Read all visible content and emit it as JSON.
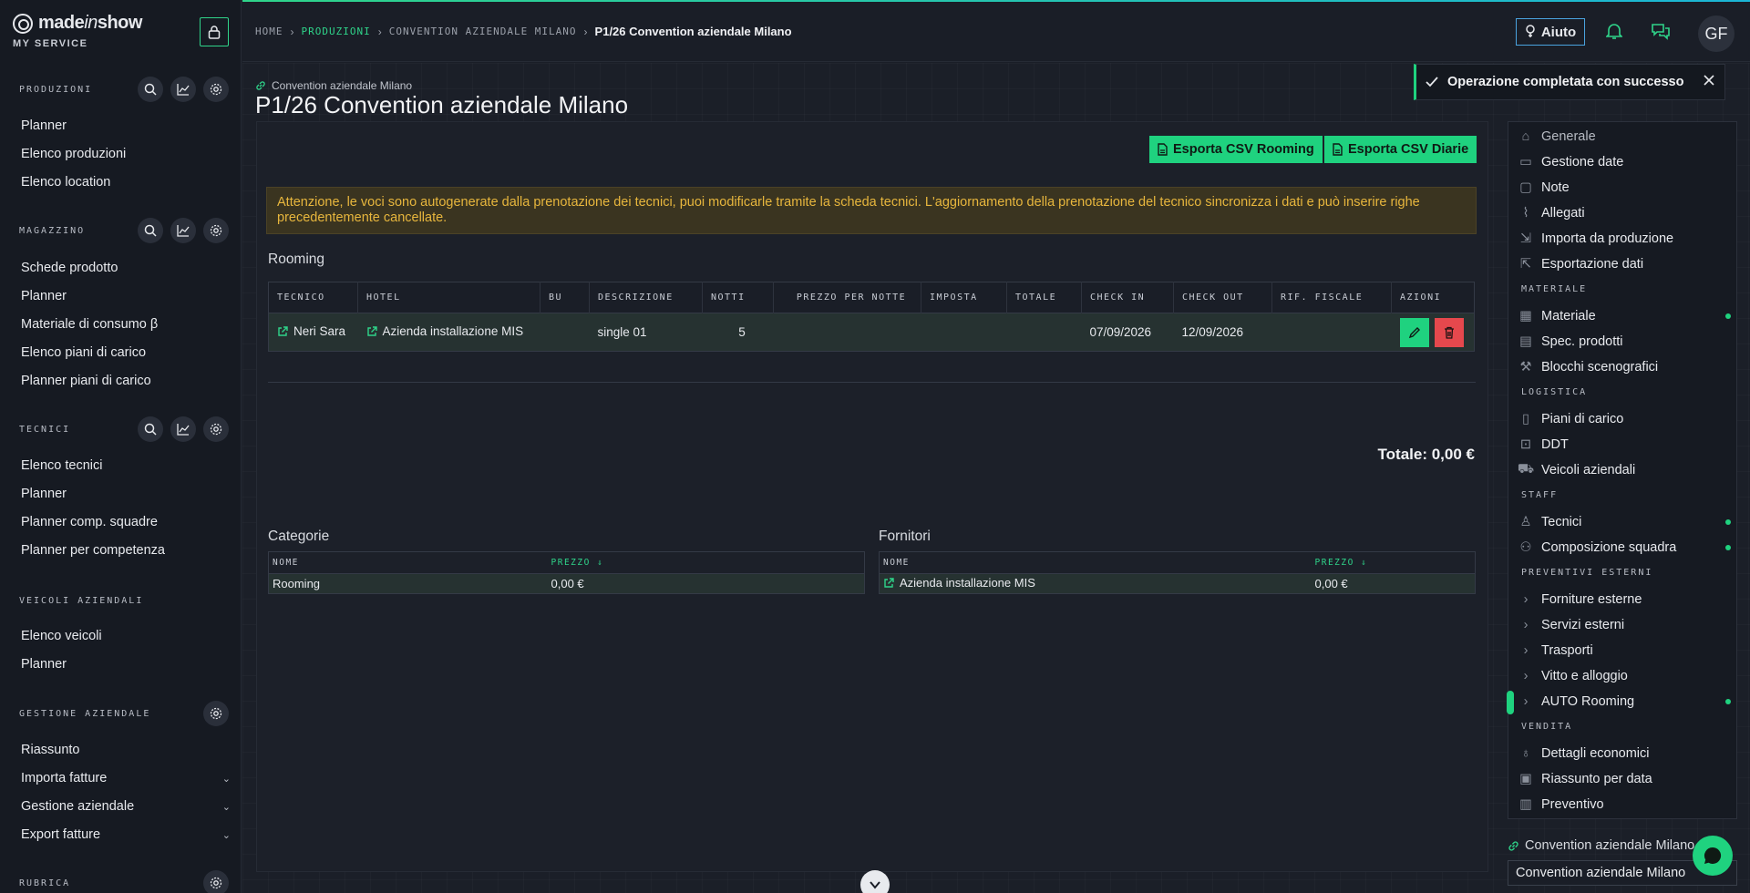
{
  "brand": {
    "name_a": "made",
    "name_b": "in",
    "name_c": "show",
    "service": "MY SERVICE"
  },
  "sidebar": {
    "produzioni": {
      "title": "PRODUZIONI",
      "items": [
        "Planner",
        "Elenco produzioni",
        "Elenco location"
      ]
    },
    "magazzino": {
      "title": "MAGAZZINO",
      "items": [
        "Schede prodotto",
        "Planner",
        "Materiale di consumo β",
        "Elenco piani di carico",
        "Planner piani di carico"
      ]
    },
    "tecnici": {
      "title": "TECNICI",
      "items": [
        "Elenco tecnici",
        "Planner",
        "Planner comp. squadre",
        "Planner per competenza"
      ]
    },
    "veicoli": {
      "title": "VEICOLI AZIENDALI",
      "items": [
        "Elenco veicoli",
        "Planner"
      ]
    },
    "gestione": {
      "title": "GESTIONE AZIENDALE",
      "items": [
        "Riassunto",
        "Importa fatture",
        "Gestione aziendale",
        "Export fatture"
      ]
    },
    "rubrica": {
      "title": "RUBRICA"
    }
  },
  "topbar": {
    "breadcrumb": [
      "HOME",
      "PRODUZIONI",
      "CONVENTION AZIENDALE MILANO"
    ],
    "current": "P1/26 Convention aziendale Milano",
    "help_label": "Aiuto",
    "avatar_initials": "GF"
  },
  "page": {
    "production_link": "Convention aziendale Milano",
    "title": "P1/26 Convention aziendale Milano",
    "export_rooming_label": "Esporta CSV Rooming",
    "export_diarie_label": "Esporta CSV Diarie",
    "warning": "Attenzione, le voci sono autogenerate dalla prenotazione dei tecnici, puoi modificarle tramite la scheda tecnici. L'aggiornamento della prenotazione del tecnico sincronizza i dati e può inserire righe precedentemente cancellate.",
    "rooming_title": "Rooming",
    "rooming_headers": [
      "TECNICO",
      "HOTEL",
      "BU",
      "DESCRIZIONE",
      "NOTTI",
      "PREZZO PER NOTTE",
      "IMPOSTA",
      "TOTALE",
      "CHECK IN",
      "CHECK OUT",
      "RIF. FISCALE",
      "AZIONI"
    ],
    "rooming_row": {
      "tecnico": "Neri Sara",
      "hotel": "Azienda installazione MIS",
      "bu": "",
      "descrizione": "single 01",
      "notti": "5",
      "prezzo": "",
      "imposta": "",
      "totale": "",
      "check_in": "07/09/2026",
      "check_out": "12/09/2026",
      "rif_fiscale": ""
    },
    "total_label": "Totale: 0,00 €",
    "categorie": {
      "title": "Categorie",
      "col_nome": "NOME",
      "col_prezzo": "PREZZO",
      "row_nome": "Rooming",
      "row_prezzo": "0,00 €"
    },
    "fornitori": {
      "title": "Fornitori",
      "col_nome": "NOME",
      "col_prezzo": "PREZZO",
      "row_nome": "Azienda installazione MIS",
      "row_prezzo": "0,00 €"
    }
  },
  "rightnav": {
    "top_items": [
      "Generale",
      "Gestione date",
      "Note",
      "Allegati",
      "Importa da produzione",
      "Esportazione dati"
    ],
    "materiale_head": "MATERIALE",
    "materiale_items": [
      "Materiale",
      "Spec. prodotti",
      "Blocchi scenografici"
    ],
    "logistica_head": "LOGISTICA",
    "logistica_items": [
      "Piani di carico",
      "DDT",
      "Veicoli aziendali"
    ],
    "staff_head": "STAFF",
    "staff_items": [
      "Tecnici",
      "Composizione squadra"
    ],
    "preventivi_head": "PREVENTIVI ESTERNI",
    "preventivi_items": [
      "Forniture esterne",
      "Servizi esterni",
      "Trasporti",
      "Vitto e alloggio",
      "AUTO Rooming"
    ],
    "vendita_head": "VENDITA",
    "vendita_items": [
      "Dettagli economici",
      "Riassunto per data",
      "Preventivo"
    ]
  },
  "bottom": {
    "conv_link": "Convention aziendale Milano",
    "conv_select": "Convention aziendale Milano"
  },
  "toast": {
    "message": "Operazione completata con successo"
  },
  "colors": {
    "accent": "#1fd27f",
    "danger": "#e5484d",
    "warning_text": "#e7b63d",
    "info": "#4aa3df"
  }
}
